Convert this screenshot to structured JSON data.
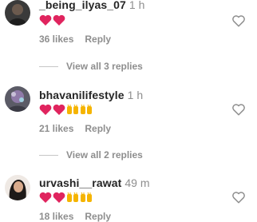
{
  "comments": [
    {
      "username": "_being_ilyas_07",
      "time": "1 h",
      "emoji_text": "❤❤",
      "likes": "36 likes",
      "reply": "Reply",
      "view_replies": "View all 3 replies"
    },
    {
      "username": "bhavanilifestyle",
      "time": "1 h",
      "emoji_text": "❤❤🙌🙌",
      "likes": "21 likes",
      "reply": "Reply",
      "view_replies": "View all 2 replies"
    },
    {
      "username": "urvashi__rawat",
      "time": "49 m",
      "emoji_text": "❤❤🙌🙌",
      "likes": "18 likes",
      "reply": "Reply"
    }
  ],
  "colors": {
    "text": "#262626",
    "muted": "#8e8e8e",
    "heart": "#e0245e",
    "hands": "#f5b400"
  },
  "icons": {
    "like": "heart-outline-icon",
    "heart_emoji": "red-heart-emoji",
    "hands_emoji": "raising-hands-emoji"
  }
}
